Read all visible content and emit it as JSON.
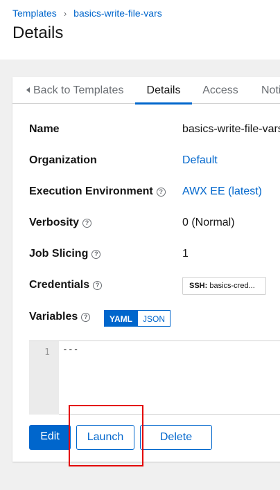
{
  "breadcrumb": {
    "parent": "Templates",
    "current": "basics-write-file-vars"
  },
  "page": {
    "title": "Details"
  },
  "tabs": {
    "back": "Back to Templates",
    "details": "Details",
    "access": "Access",
    "notifications": "Noti"
  },
  "details": {
    "name": {
      "label": "Name",
      "value": "basics-write-file-vars"
    },
    "organization": {
      "label": "Organization",
      "value": "Default"
    },
    "execution_environment": {
      "label": "Execution Environment",
      "value": "AWX EE (latest)"
    },
    "verbosity": {
      "label": "Verbosity",
      "value": "0 (Normal)"
    },
    "job_slicing": {
      "label": "Job Slicing",
      "value": "1"
    },
    "credentials": {
      "label": "Credentials",
      "chip_kind": "SSH:",
      "chip_value": "basics-cred..."
    },
    "variables": {
      "label": "Variables",
      "yaml": "YAML",
      "json": "JSON"
    }
  },
  "editor": {
    "line_number": "1",
    "content": "---"
  },
  "actions": {
    "edit": "Edit",
    "launch": "Launch",
    "delete": "Delete"
  },
  "help_glyph": "?",
  "colors": {
    "link": "#0066cc",
    "highlight": "#e30000"
  }
}
